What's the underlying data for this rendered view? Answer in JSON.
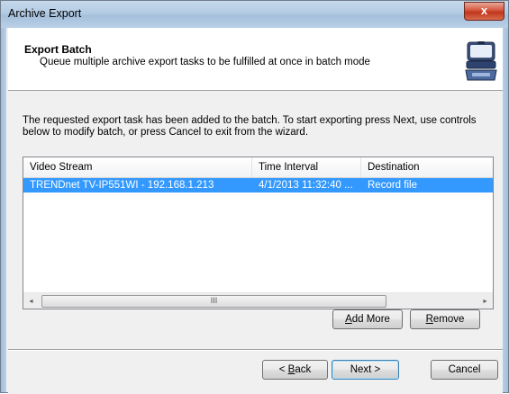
{
  "window": {
    "title": "Archive Export",
    "close_glyph": "x"
  },
  "header": {
    "title": "Export Batch",
    "subtitle": "Queue multiple archive export tasks to be fulfilled at once in batch mode",
    "icon": "export-device-icon"
  },
  "description": "The requested export task has been added to the batch. To start exporting press Next, use controls below to modify batch, or press Cancel to exit from the wizard.",
  "list": {
    "columns": [
      "Video Stream",
      "Time Interval",
      "Destination"
    ],
    "rows": [
      {
        "stream": "TRENDnet TV-IP551WI - 192.168.1.213",
        "interval": "4/1/2013 11:32:40 ...",
        "destination": "Record file",
        "selected": true
      }
    ],
    "scrollbar": {
      "left_arrow": "◂",
      "right_arrow": "▸",
      "grip": "III"
    }
  },
  "buttons": {
    "add_more_accel": "A",
    "add_more_rest": "dd More",
    "remove_accel": "R",
    "remove_rest": "emove",
    "back_pre": "< ",
    "back_accel": "B",
    "back_rest": "ack",
    "next": "Next >",
    "cancel": "Cancel"
  },
  "colors": {
    "selection": "#3399ff",
    "title_gradient": "#b3cbe3",
    "close": "#c1361c"
  }
}
